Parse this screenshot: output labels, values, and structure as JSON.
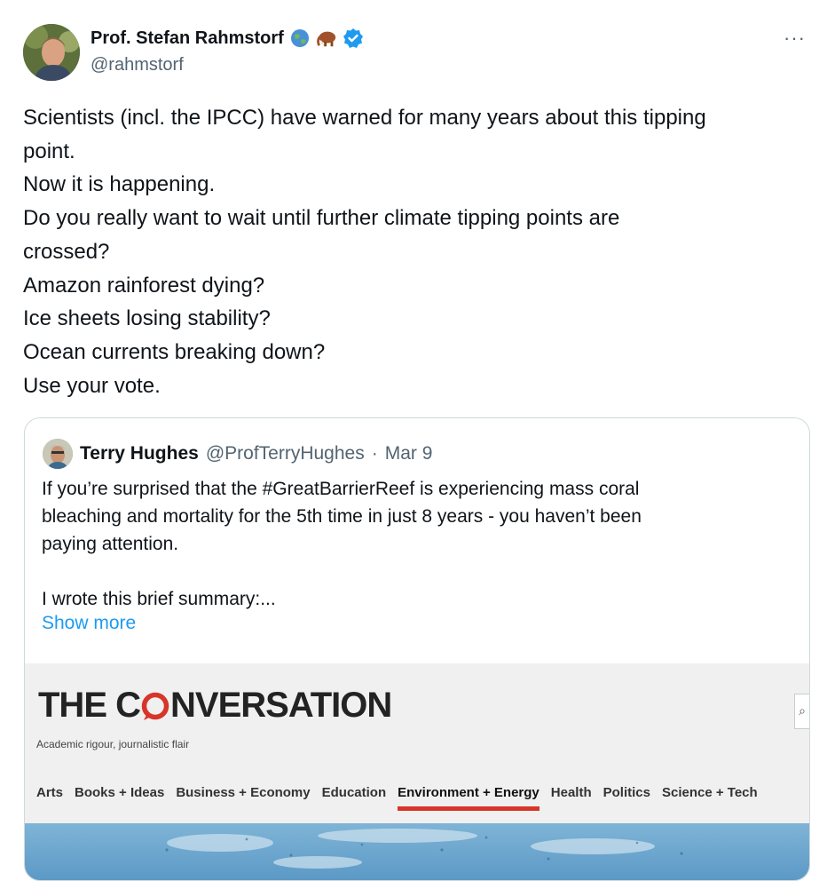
{
  "author": {
    "display_name": "Prof. Stefan Rahmstorf",
    "handle": "@rahmstorf",
    "badges": [
      "globe-emoji-icon",
      "mammoth-emoji-icon",
      "verified-badge-icon"
    ]
  },
  "more_menu": "···",
  "tweet": {
    "lines": [
      "Scientists (incl. the IPCC) have warned for many years about this tipping",
      "point.",
      "Now it is happening.",
      "Do you really want to wait until further climate tipping points are",
      "crossed?",
      "Amazon rainforest dying?",
      "Ice sheets losing stability?",
      "Ocean currents breaking down?",
      "Use your vote."
    ]
  },
  "quoted": {
    "name": "Terry Hughes",
    "handle": "@ProfTerryHughes",
    "separator": "·",
    "date": "Mar 9",
    "text_lines": [
      "If you’re surprised that the #GreatBarrierReef is experiencing mass coral",
      "bleaching and mortality for the 5th time in just 8 years - you haven’t been",
      "paying attention.",
      "",
      "I wrote this brief summary:..."
    ],
    "show_more": "Show more"
  },
  "link_preview": {
    "logo_before": "THE C",
    "logo_after": "NVERSATION",
    "tagline": "Academic rigour, journalistic flair",
    "nav": [
      "Arts",
      "Books + Ideas",
      "Business + Economy",
      "Education",
      "Environment + Energy",
      "Health",
      "Politics",
      "Science + Tech"
    ],
    "active_nav": "Environment + Energy",
    "colors": {
      "logo_accent": "#d8352a",
      "image_sea": "#6aa4cd"
    }
  },
  "colors": {
    "link": "#1d9bf0",
    "muted": "#536471",
    "verified": "#1d9bf0"
  }
}
